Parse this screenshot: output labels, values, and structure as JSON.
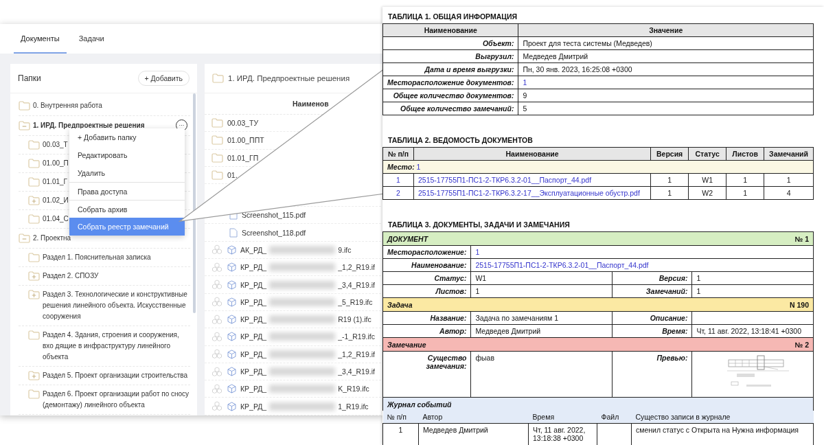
{
  "tabs": [
    {
      "label": "Документы",
      "selected": true
    },
    {
      "label": "Задачи",
      "selected": false
    }
  ],
  "folders_panel": {
    "title": "Папки",
    "add_button": "+ Добавить",
    "tree": [
      {
        "label": "0. Внутренняя работа",
        "kind": "folder",
        "selected": false
      },
      {
        "label": "1. ИРД. Предпроектные решения",
        "kind": "collapse",
        "selected": true,
        "more_button": "···",
        "children": [
          {
            "label": "00.03_Т",
            "kind": "folder",
            "selected": false
          },
          {
            "label": "01.00_П",
            "kind": "folder",
            "selected": false
          },
          {
            "label": "01.01_Г",
            "kind": "folder",
            "selected": false
          },
          {
            "label": "01.02_И",
            "kind": "expand",
            "selected": false
          },
          {
            "label": "01.04_С",
            "kind": "folder",
            "selected": false
          }
        ]
      },
      {
        "label": "2. Проектна",
        "kind": "collapse",
        "selected": false,
        "children": [
          {
            "label": "Раздел 1. Пояснительная записка",
            "kind": "folder",
            "selected": false
          },
          {
            "label": "Раздел 2. СПОЗУ",
            "kind": "expand",
            "selected": false
          },
          {
            "label": "Раздел 3. Технологические и конструктивные решения линейного объекта. Искусственные сооружения",
            "kind": "expand",
            "selected": false
          },
          {
            "label": "Раздел 4. Здания, строения и сооружения, вхо дящие в инфраструктуру линейного объекта",
            "kind": "folder",
            "selected": false
          },
          {
            "label": "Раздел 5. Проект организации строительства",
            "kind": "expand",
            "selected": false
          },
          {
            "label": "Раздел 6. Проект организации работ по сносу (демонтажу) линейного объекта",
            "kind": "folder",
            "selected": false
          }
        ]
      }
    ]
  },
  "context_menu": {
    "items": [
      {
        "label": "+ Добавить папку",
        "selected": false,
        "divider_before": false
      },
      {
        "label": "Редактировать",
        "selected": false,
        "divider_before": false
      },
      {
        "label": "Удалить",
        "selected": false,
        "divider_before": false
      },
      {
        "label": "Права доступа",
        "selected": false,
        "divider_before": true
      },
      {
        "label": "Собрать архив",
        "selected": false,
        "divider_before": true
      },
      {
        "label": "Собрать реестр замечаний",
        "selected": true,
        "divider_before": false
      }
    ]
  },
  "files_panel": {
    "title": "1. ИРД. Предпроектные решения",
    "column": "Наименов",
    "rows": [
      {
        "kind": "folder",
        "name": "00.03_ТУ"
      },
      {
        "kind": "folder",
        "name": "01.00_ППТ"
      },
      {
        "kind": "folder",
        "name": "01.01_ГП"
      },
      {
        "kind": "folder",
        "name": "01."
      },
      {
        "kind": "hidden"
      },
      {
        "kind": "pdf",
        "name": "Screenshot_115.pdf"
      },
      {
        "kind": "pdf",
        "name": "Screenshot_118.pdf"
      },
      {
        "kind": "ifc",
        "name_start": "АК_РД_",
        "name_end": "9.ifc"
      },
      {
        "kind": "ifc",
        "name_start": "КР_РД_",
        "name_end": "_1,2_R19.if"
      },
      {
        "kind": "ifc",
        "name_start": "КР_РД_",
        "name_end": "_3,4_R19.if"
      },
      {
        "kind": "ifc",
        "name_start": "КР_РД_",
        "name_end": "_5_R19.ifc"
      },
      {
        "kind": "ifc",
        "name_start": "КР_РД_",
        "name_end": "R19 (1).ifc"
      },
      {
        "kind": "ifc",
        "name_start": "КР_РД_",
        "name_end": "_-1_R19.ifc"
      },
      {
        "kind": "ifc",
        "name_start": "КР_РД_",
        "name_end": "_1,2_R19.if"
      },
      {
        "kind": "ifc",
        "name_start": "КР_РД_",
        "name_end": "_3,4_R19.if"
      },
      {
        "kind": "ifc",
        "name_start": "КР_РД_",
        "name_end": "K_R19.ifc"
      },
      {
        "kind": "ifc",
        "name_start": "КР_РД_",
        "name_end": "1_R19.ifc"
      }
    ]
  },
  "report": {
    "table1": {
      "title": "ТАБЛИЦА 1. ОБЩАЯ ИНФОРМАЦИЯ",
      "columns": [
        "Наименование",
        "Значение"
      ],
      "rows": [
        {
          "label": "Объект:",
          "value": "Проект для теста системы (Медведев)",
          "kind": "text"
        },
        {
          "label": "Выгрузил:",
          "value": "Медведев Дмитрий",
          "kind": "text"
        },
        {
          "label": "Дата и время выгрузки:",
          "value": "Пн, 30 янв. 2023, 16:25:08 +0300",
          "kind": "text"
        },
        {
          "label": "Месторасположение документов:",
          "value": "1",
          "kind": "link"
        },
        {
          "label": "Общее количество документов:",
          "value": "9",
          "kind": "text"
        },
        {
          "label": "Общее количество замечаний:",
          "value": "5",
          "kind": "text"
        }
      ]
    },
    "table2": {
      "title": "ТАБЛИЦА 2. ВЕДОМОСТЬ ДОКУМЕНТОВ",
      "columns": [
        "№ п/п",
        "Наименование",
        "Версия",
        "Статус",
        "Листов",
        "Замечаний"
      ],
      "group_label": "Место:",
      "group_value": "1",
      "rows": [
        [
          "1",
          "2515-17755П1-ПС1-2-ТКР6.3.2-01__Паспорт_44.pdf",
          "1",
          "W1",
          "1",
          "1"
        ],
        [
          "2",
          "2515-17755П1-ПС1-2-ТКР6.3.2-17__Эксплуатационные обустр.pdf",
          "1",
          "W2",
          "1",
          "4"
        ]
      ]
    },
    "table3": {
      "title": "ТАБЛИЦА 3. ДОКУМЕНТЫ, ЗАДАЧИ И ЗАМЕЧАНИЯ",
      "document": {
        "heading": "ДОКУМЕНТ",
        "number": "№ 1",
        "location_label": "Месторасположение:",
        "location": "1",
        "name_label": "Наименование:",
        "name": "2515-17755П1-ПС1-2-ТКР6.3.2-01__Паспорт_44.pdf",
        "fields": [
          {
            "label": "Статус:",
            "value": "W1"
          },
          {
            "label": "Версия:",
            "value": "1"
          },
          {
            "label": "Листов:",
            "value": "1"
          },
          {
            "label": "Замечаний:",
            "value": "1"
          }
        ]
      },
      "task": {
        "heading": "Задача",
        "number": "N 190",
        "fields": [
          {
            "label": "Название:",
            "value": "Задача по замечаниям 1"
          },
          {
            "label": "Описание:"
          },
          {
            "label": "Автор:",
            "value": "Медведев Дмитрий"
          },
          {
            "label": "Время:",
            "value": "Чт, 11 авг. 2022, 13:18:41 +0300"
          }
        ]
      },
      "remark": {
        "heading": "Замечание",
        "number": "№ 2",
        "essence_label": "Существо замечания:",
        "essence": "фыав",
        "preview_label": "Превью:"
      },
      "journal": {
        "heading": "Журнал событий",
        "columns": [
          "№ п/п",
          "Автор",
          "Время",
          "Файл",
          "Существо записи в журнале"
        ],
        "rows": [
          [
            "1",
            "Медведев Дмитрий",
            "Чт, 11 авг. 2022, 13:18:38 +0300",
            null,
            "сменил статус с Открыта на Нужна информация"
          ]
        ]
      }
    }
  }
}
